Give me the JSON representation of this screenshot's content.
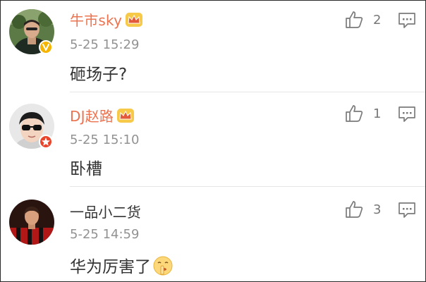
{
  "comments": [
    {
      "username": "牛市sky",
      "timestamp": "5-25 15:29",
      "text": "砸场子?",
      "likes": "2",
      "vip": true,
      "verified_badge": "yellow-v-badge",
      "name_color": "#eb7350"
    },
    {
      "username": "DJ赵路",
      "timestamp": "5-25 15:10",
      "text": "卧槽",
      "likes": "1",
      "vip": true,
      "verified_badge": "red-star-badge",
      "name_color": "#eb7350"
    },
    {
      "username": "一品小二货",
      "timestamp": "5-25 14:59",
      "text": "华为厉害了",
      "likes": "3",
      "vip": false,
      "emoji": "shush-face-emoji",
      "name_color": "#333333"
    }
  ],
  "icons": {
    "like": "thumbs-up-icon",
    "reply": "comment-reply-icon",
    "vip": "crown-icon"
  }
}
